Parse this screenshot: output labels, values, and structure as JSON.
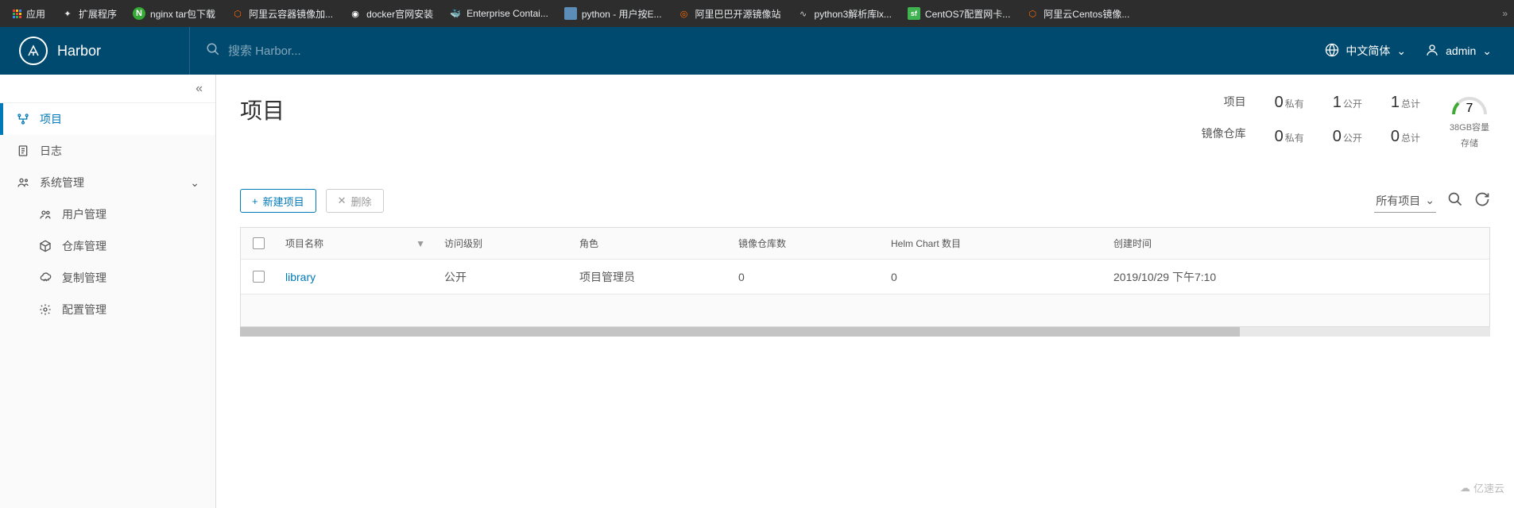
{
  "bookmarks": {
    "apps": "应用",
    "extensions": "扩展程序",
    "items": [
      {
        "label": "nginx tar包下载",
        "color": "#35a935"
      },
      {
        "label": "阿里云容器镜像加...",
        "color": "#ff6a00"
      },
      {
        "label": "docker官网安装",
        "color": "#ffffff"
      },
      {
        "label": "Enterprise Contai...",
        "color": "#0db7ed"
      },
      {
        "label": "python - 用户按E...",
        "color": "#3776ab"
      },
      {
        "label": "阿里巴巴开源镜像站",
        "color": "#ff6a00"
      },
      {
        "label": "python3解析库lx...",
        "color": "#cccccc"
      },
      {
        "label": "CentOS7配置网卡...",
        "color": "#3fb34f"
      },
      {
        "label": "阿里云Centos镜像...",
        "color": "#ff6a00"
      }
    ]
  },
  "header": {
    "brand": "Harbor",
    "search_placeholder": "搜索 Harbor...",
    "language": "中文简体",
    "user": "admin"
  },
  "sidebar": {
    "projects": "项目",
    "logs": "日志",
    "sysadmin": "系统管理",
    "user_mgmt": "用户管理",
    "repo_mgmt": "仓库管理",
    "replication": "复制管理",
    "config": "配置管理"
  },
  "main": {
    "title": "项目",
    "stats": {
      "project_label": "项目",
      "repo_label": "镜像仓库",
      "private_suffix": "私有",
      "public_suffix": "公开",
      "total_suffix": "总计",
      "project_private": "0",
      "project_public": "1",
      "project_total": "1",
      "repo_private": "0",
      "repo_public": "0",
      "repo_total": "0",
      "storage_value": "7",
      "storage_cap": "38GB容量",
      "storage_label": "存储"
    },
    "actions": {
      "new_project": "新建项目",
      "delete": "删除",
      "filter_all": "所有项目"
    },
    "table": {
      "headers": {
        "name": "项目名称",
        "access": "访问级别",
        "role": "角色",
        "repos": "镜像仓库数",
        "helm": "Helm Chart 数目",
        "created": "创建时间"
      },
      "rows": [
        {
          "name": "library",
          "access": "公开",
          "role": "项目管理员",
          "repos": "0",
          "helm": "0",
          "created": "2019/10/29 下午7:10"
        }
      ]
    }
  },
  "watermark": "亿速云"
}
